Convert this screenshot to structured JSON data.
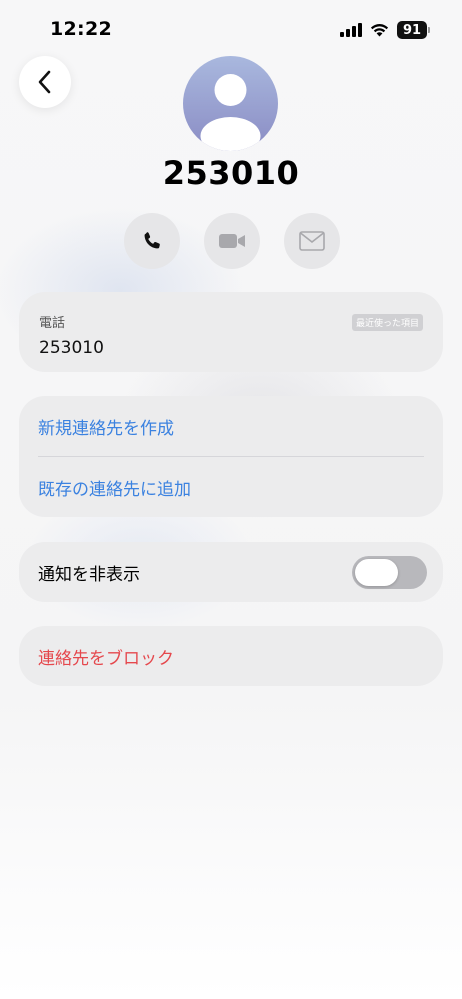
{
  "status_bar": {
    "time": "12:22",
    "battery": "91",
    "icons": [
      "signal-icon",
      "wifi-icon",
      "battery-icon"
    ]
  },
  "header": {
    "back_icon": "chevron-left-icon",
    "avatar_icon": "person-silhouette-icon",
    "contact_name": "253010"
  },
  "actions": [
    {
      "name": "call",
      "icon": "phone-icon",
      "enabled": true
    },
    {
      "name": "video",
      "icon": "video-camera-icon",
      "enabled": false
    },
    {
      "name": "mail",
      "icon": "envelope-icon",
      "enabled": false
    }
  ],
  "phone_card": {
    "label": "電話",
    "number": "253010",
    "badge": "最近使った項目"
  },
  "add_card": {
    "create_new": "新規連絡先を作成",
    "add_existing": "既存の連絡先に追加"
  },
  "notify_card": {
    "label": "通知を非表示",
    "toggle_on": false
  },
  "block_card": {
    "label": "連絡先をブロック"
  },
  "colors": {
    "link_blue": "#3b82e0",
    "destructive_red": "#e5484d",
    "card_bg": "#ececed"
  }
}
